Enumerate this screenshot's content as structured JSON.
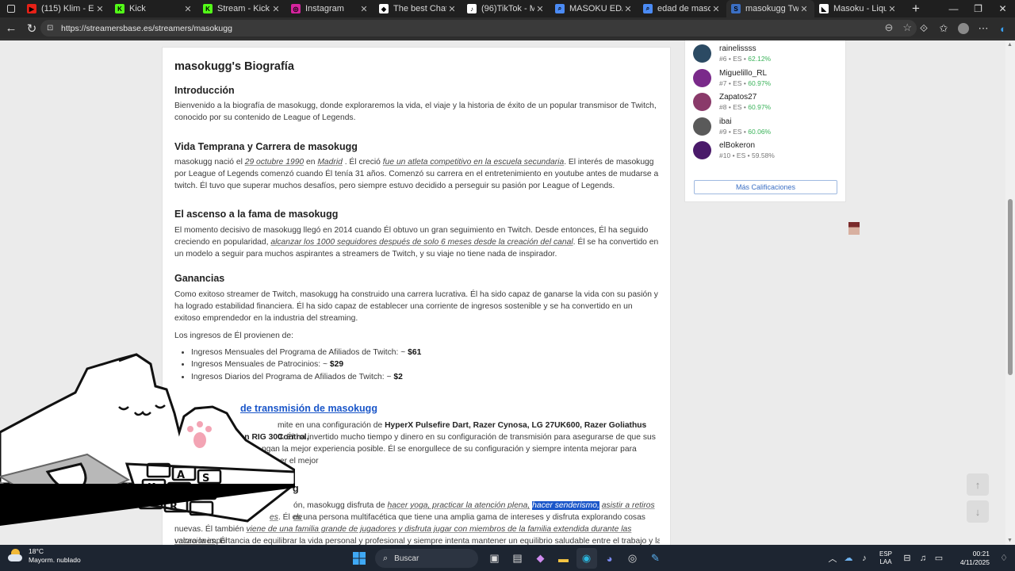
{
  "browser": {
    "tabs": [
      {
        "title": "(115) Klim - Es",
        "fav_color": "#e62117",
        "fav_glyph": "▶"
      },
      {
        "title": "Kick",
        "fav_color": "#53fc18",
        "fav_glyph": "K"
      },
      {
        "title": "Stream - Kick Dashb",
        "fav_color": "#53fc18",
        "fav_glyph": "K"
      },
      {
        "title": "Instagram",
        "fav_color": "#d6249f",
        "fav_glyph": "◎"
      },
      {
        "title": "The best ChatBot ar",
        "fav_color": "#ffffff",
        "fav_glyph": "◆"
      },
      {
        "title": "(96)TikTok - Make Y",
        "fav_color": "#ffffff",
        "fav_glyph": "♪"
      },
      {
        "title": "MASOKU EDAD - Bi",
        "fav_color": "#4b8bf5",
        "fav_glyph": "⌕"
      },
      {
        "title": "edad de masoku - B",
        "fav_color": "#4b8bf5",
        "fav_glyph": "⌕"
      },
      {
        "title": "masokugg Twitch Str",
        "fav_color": "#3b6fc4",
        "fav_glyph": "S"
      },
      {
        "title": "Masoku - Liquipedi",
        "fav_color": "#ffffff",
        "fav_glyph": "◣"
      }
    ],
    "url": "https://streamersbase.es/streamers/masokugg"
  },
  "article": {
    "title": "masokugg's Biografía",
    "intro_heading": "Introducción",
    "intro_text": "Bienvenido a la biografía de masokugg, donde exploraremos la vida, el viaje y la historia de éxito de un popular transmisor de Twitch, conocido por su contenido de League of Legends.",
    "early_heading": "Vida Temprana y Carrera de masokugg",
    "early_1": "masokugg nació el ",
    "early_date": "29 octubre 1990",
    "early_2": " en ",
    "early_place": "Madrid",
    "early_3": " . Él creció ",
    "early_em": "fue un atleta competitivo en la escuela secundaria",
    "early_4": ". El interés de masokugg por League of Legends comenzó cuando Él tenía 31 años. Comenzó su carrera en el entretenimiento en youtube antes de mudarse a twitch. Él tuvo que superar muchos desafíos, pero siempre estuvo decidido a perseguir su pasión por League of Legends.",
    "rise_heading": "El ascenso a la fama de masokugg",
    "rise_1": "El momento decisivo de masokugg llegó en 2014 cuando Él obtuvo un gran seguimiento en Twitch. Desde entonces, Él ha seguido creciendo en popularidad, ",
    "rise_em": "alcanzar los 1000 seguidores después de solo 6 meses desde la creación del canal",
    "rise_2": ". Él se ha convertido en un modelo a seguir para muchos aspirantes a streamers de Twitch, y su viaje no tiene nada de inspirador.",
    "earn_heading": "Ganancias",
    "earn_text": "Como exitoso streamer de Twitch, masokugg ha construido una carrera lucrativa. Él ha sido capaz de ganarse la vida con su pasión y ha logrado estabilidad financiera. Él ha sido capaz de establecer una corriente de ingresos sostenible y se ha convertido en un exitoso emprendedor en la industria del streaming.",
    "income_intro": "Los ingresos de Él provienen de:",
    "income": [
      {
        "label": "Ingresos Mensuales del Programa de Afiliados de Twitch: ~ ",
        "value": "$61"
      },
      {
        "label": "Ingresos Mensuales de Patrocinios: ~ ",
        "value": "$29"
      },
      {
        "label": "Ingresos Diarios del Programa de Afiliados de Twitch: ~ ",
        "value": "$2"
      }
    ],
    "setup_heading": "de transmisión de masokugg",
    "setup_1": "mite en una configuración de ",
    "setup_gear_a": "HyperX Pulsefire Dart, Razer Cynosa, LG 27UK600, Razer Goliathus Control,",
    "setup_gear_b": "on RIG 300",
    "setup_2": ". Él ha invertido mucho tiempo y dinero en su configuración de transmisión para asegurarse de que sus",
    "setup_3": "ngan la mejor experiencia posible. Él se enorgullece de su configuración y siempre intenta mejorar para ofrecer el mejor",
    "setup_4": "ı.",
    "life_heading_frag": "g",
    "life_1": "ón, masokugg disfruta de ",
    "life_em1": "hacer yoga, practicar la atención plena,",
    "life_hl": "hacer senderismo,",
    "life_em2": "asistir a retiros de",
    "life_2a": "es",
    "life_2b": ". Él es una persona multifacética que tiene una amplia gama de intereses y disfruta explorando cosas",
    "life_3a": "nuevas. Él también ",
    "life_em3": "viene de una familia grande de jugadores y disfruta jugar con miembros de la familia extendida durante las vacaciones",
    "life_3b": ". Él",
    "life_4": "valora la importancia de equilibrar la vida personal y profesional y siempre intenta mantener un equilibrio saludable entre el trabajo y la"
  },
  "ranking": {
    "items": [
      {
        "name": "rainelissss",
        "rank": "#6",
        "lang": "ES",
        "pct": "62.12%",
        "pct_green": true,
        "avatar": "#2b4a63"
      },
      {
        "name": "Miguelillo_RL",
        "rank": "#7",
        "lang": "ES",
        "pct": "60.97%",
        "pct_green": true,
        "avatar": "#7a2a8a"
      },
      {
        "name": "Zapatos27",
        "rank": "#8",
        "lang": "ES",
        "pct": "60.97%",
        "pct_green": true,
        "avatar": "#8a3a6a"
      },
      {
        "name": "ibai",
        "rank": "#9",
        "lang": "ES",
        "pct": "60.06%",
        "pct_green": true,
        "avatar": "#5a5a5a"
      },
      {
        "name": "elBokeron",
        "rank": "#10",
        "lang": "ES",
        "pct": "59.58%",
        "pct_green": false,
        "avatar": "#4a1a6a"
      }
    ],
    "sep": "•",
    "more_button": "Más Calificaciones"
  },
  "overlay": {
    "keycaps": "ASKWMR",
    "brand": "bongo-cat"
  },
  "taskbar": {
    "temp": "18°C",
    "weather": "Mayorm. nublado",
    "search": "Buscar",
    "lang_top": "ESP",
    "lang_bottom": "LAA",
    "time": "00:21",
    "date": "4/11/2025"
  }
}
